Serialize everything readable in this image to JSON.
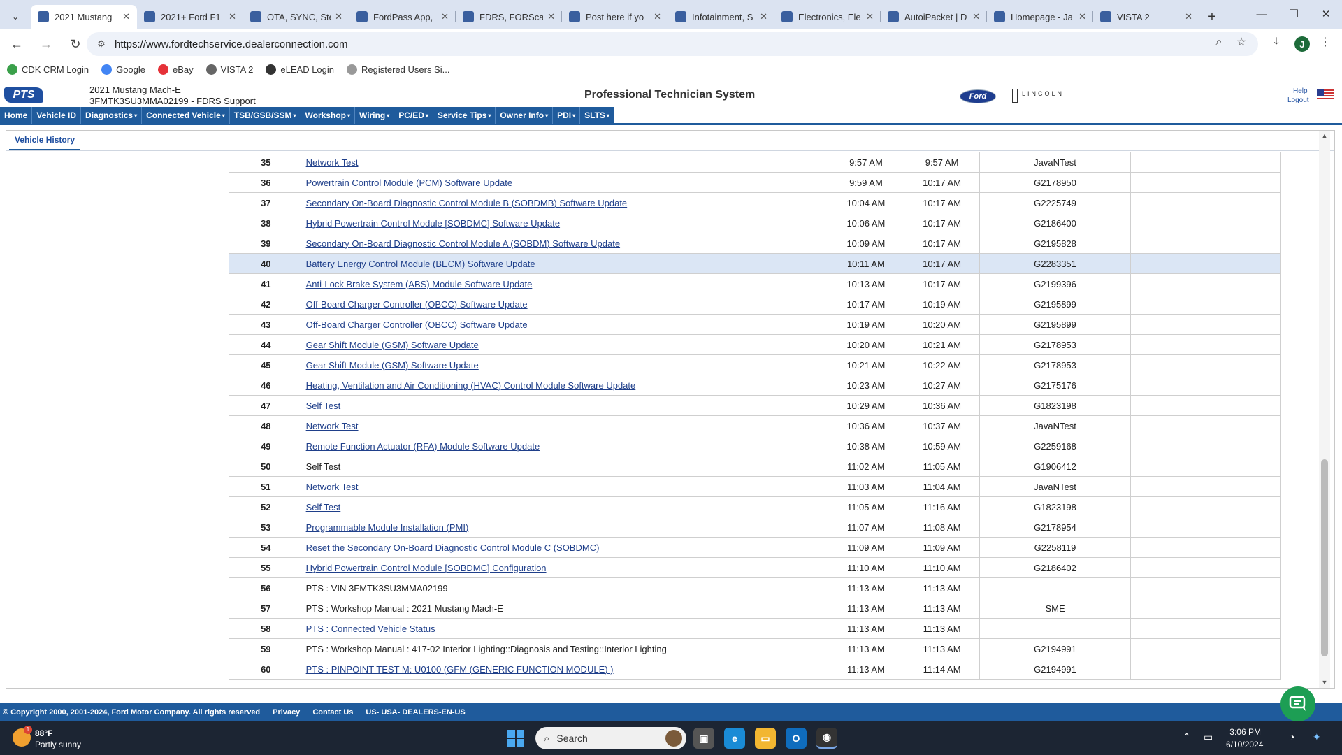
{
  "browser": {
    "tabs": [
      {
        "title": "2021 Mustang",
        "active": true
      },
      {
        "title": "2021+ Ford F1"
      },
      {
        "title": "OTA, SYNC, Ste"
      },
      {
        "title": "FordPass App,"
      },
      {
        "title": "FDRS, FORScar"
      },
      {
        "title": "Post here if yo"
      },
      {
        "title": "Infotainment, S"
      },
      {
        "title": "Electronics, Ele"
      },
      {
        "title": "AutoiPacket | D"
      },
      {
        "title": "Homepage - Ja"
      },
      {
        "title": "VISTA 2"
      }
    ],
    "url": "https://www.fordtechservice.dealerconnection.com",
    "profile_initial": "J",
    "bookmarks": [
      {
        "label": "CDK CRM Login",
        "color": "#3aa04a"
      },
      {
        "label": "Google",
        "color": "#4285f4"
      },
      {
        "label": "eBay",
        "color": "#e53238"
      },
      {
        "label": "VISTA 2",
        "color": "#666666"
      },
      {
        "label": "eLEAD Login",
        "color": "#333333"
      },
      {
        "label": "Registered Users Si...",
        "color": "#999999"
      }
    ]
  },
  "header": {
    "logo": "PTS",
    "vehicle_model": "2021 Mustang Mach-E",
    "vehicle_vin_line": "3FMTK3SU3MMA02199 - FDRS Support",
    "title": "Professional Technician System",
    "ford_logo": "Ford",
    "lincoln": "LINCOLN",
    "help": "Help",
    "logout": "Logout"
  },
  "nav": [
    "Home",
    "Vehicle ID",
    "Diagnostics",
    "Connected Vehicle",
    "TSB/GSB/SSM",
    "Workshop",
    "Wiring",
    "PC/ED",
    "Service Tips",
    "Owner Info",
    "PDI",
    "SLTS"
  ],
  "subtab": "Vehicle History",
  "history_rows": [
    {
      "num": "35",
      "desc": "Network Test",
      "link": true,
      "start": "9:57 AM",
      "end": "9:57 AM",
      "id": "JavaNTest"
    },
    {
      "num": "36",
      "desc": "Powertrain Control Module (PCM) Software Update",
      "link": true,
      "start": "9:59 AM",
      "end": "10:17 AM",
      "id": "G2178950"
    },
    {
      "num": "37",
      "desc": "Secondary On-Board Diagnostic Control Module B (SOBDMB) Software Update",
      "link": true,
      "start": "10:04 AM",
      "end": "10:17 AM",
      "id": "G2225749"
    },
    {
      "num": "38",
      "desc": "Hybrid Powertrain Control Module [SOBDMC] Software Update",
      "link": true,
      "start": "10:06 AM",
      "end": "10:17 AM",
      "id": "G2186400"
    },
    {
      "num": "39",
      "desc": "Secondary On-Board Diagnostic Control Module A (SOBDM) Software Update",
      "link": true,
      "start": "10:09 AM",
      "end": "10:17 AM",
      "id": "G2195828"
    },
    {
      "num": "40",
      "desc": "Battery Energy Control Module (BECM) Software Update",
      "link": true,
      "start": "10:11 AM",
      "end": "10:17 AM",
      "id": "G2283351",
      "highlight": true
    },
    {
      "num": "41",
      "desc": "Anti-Lock Brake System (ABS) Module Software Update",
      "link": true,
      "start": "10:13 AM",
      "end": "10:17 AM",
      "id": "G2199396"
    },
    {
      "num": "42",
      "desc": "Off-Board Charger Controller (OBCC) Software Update",
      "link": true,
      "start": "10:17 AM",
      "end": "10:19 AM",
      "id": "G2195899"
    },
    {
      "num": "43",
      "desc": "Off-Board Charger Controller (OBCC) Software Update",
      "link": true,
      "start": "10:19 AM",
      "end": "10:20 AM",
      "id": "G2195899"
    },
    {
      "num": "44",
      "desc": "Gear Shift Module (GSM) Software Update",
      "link": true,
      "start": "10:20 AM",
      "end": "10:21 AM",
      "id": "G2178953"
    },
    {
      "num": "45",
      "desc": "Gear Shift Module (GSM) Software Update",
      "link": true,
      "start": "10:21 AM",
      "end": "10:22 AM",
      "id": "G2178953"
    },
    {
      "num": "46",
      "desc": "Heating, Ventilation and Air Conditioning (HVAC) Control Module Software Update",
      "link": true,
      "start": "10:23 AM",
      "end": "10:27 AM",
      "id": "G2175176"
    },
    {
      "num": "47",
      "desc": "Self Test",
      "link": true,
      "start": "10:29 AM",
      "end": "10:36 AM",
      "id": "G1823198"
    },
    {
      "num": "48",
      "desc": "Network Test",
      "link": true,
      "start": "10:36 AM",
      "end": "10:37 AM",
      "id": "JavaNTest"
    },
    {
      "num": "49",
      "desc": "Remote Function Actuator (RFA) Module Software Update",
      "link": true,
      "start": "10:38 AM",
      "end": "10:59 AM",
      "id": "G2259168"
    },
    {
      "num": "50",
      "desc": "Self Test",
      "link": false,
      "start": "11:02 AM",
      "end": "11:05 AM",
      "id": "G1906412"
    },
    {
      "num": "51",
      "desc": "Network Test",
      "link": true,
      "start": "11:03 AM",
      "end": "11:04 AM",
      "id": "JavaNTest"
    },
    {
      "num": "52",
      "desc": "Self Test",
      "link": true,
      "start": "11:05 AM",
      "end": "11:16 AM",
      "id": "G1823198"
    },
    {
      "num": "53",
      "desc": "Programmable Module Installation (PMI)",
      "link": true,
      "start": "11:07 AM",
      "end": "11:08 AM",
      "id": "G2178954"
    },
    {
      "num": "54",
      "desc": "Reset the Secondary On-Board Diagnostic Control Module C (SOBDMC)",
      "link": true,
      "start": "11:09 AM",
      "end": "11:09 AM",
      "id": "G2258119"
    },
    {
      "num": "55",
      "desc": "Hybrid Powertrain Control Module [SOBDMC] Configuration",
      "link": true,
      "start": "11:10 AM",
      "end": "11:10 AM",
      "id": "G2186402"
    },
    {
      "num": "56",
      "desc": "PTS : VIN 3FMTK3SU3MMA02199",
      "link": false,
      "start": "11:13 AM",
      "end": "11:13 AM",
      "id": ""
    },
    {
      "num": "57",
      "desc": "PTS : Workshop Manual : 2021 Mustang Mach-E",
      "link": false,
      "start": "11:13 AM",
      "end": "11:13 AM",
      "id": "SME"
    },
    {
      "num": "58",
      "desc": "PTS : Connected Vehicle Status",
      "link": true,
      "start": "11:13 AM",
      "end": "11:13 AM",
      "id": ""
    },
    {
      "num": "59",
      "desc": "PTS : Workshop Manual : 417-02 Interior Lighting::Diagnosis and Testing::Interior Lighting",
      "link": false,
      "start": "11:13 AM",
      "end": "11:13 AM",
      "id": "G2194991"
    },
    {
      "num": "60",
      "desc": "PTS : PINPOINT TEST M: U0100 (GFM (GENERIC FUNCTION MODULE) )",
      "link": true,
      "start": "11:13 AM",
      "end": "11:14 AM",
      "id": "G2194991"
    }
  ],
  "footer": {
    "copyright": "© Copyright 2000, 2001-2024, Ford Motor Company. All rights reserved",
    "privacy": "Privacy",
    "contact": "Contact Us",
    "locale": "US- USA- DEALERS-EN-US"
  },
  "taskbar": {
    "temp": "88°F",
    "condition": "Partly sunny",
    "weather_badge": "1",
    "search": "Search",
    "time": "3:06 PM",
    "date": "6/10/2024"
  },
  "colors": {
    "accent": "#1f5b9c",
    "link": "#1f3f8a",
    "highlight_row": "#dbe6f5",
    "chat": "#1d9e54"
  }
}
